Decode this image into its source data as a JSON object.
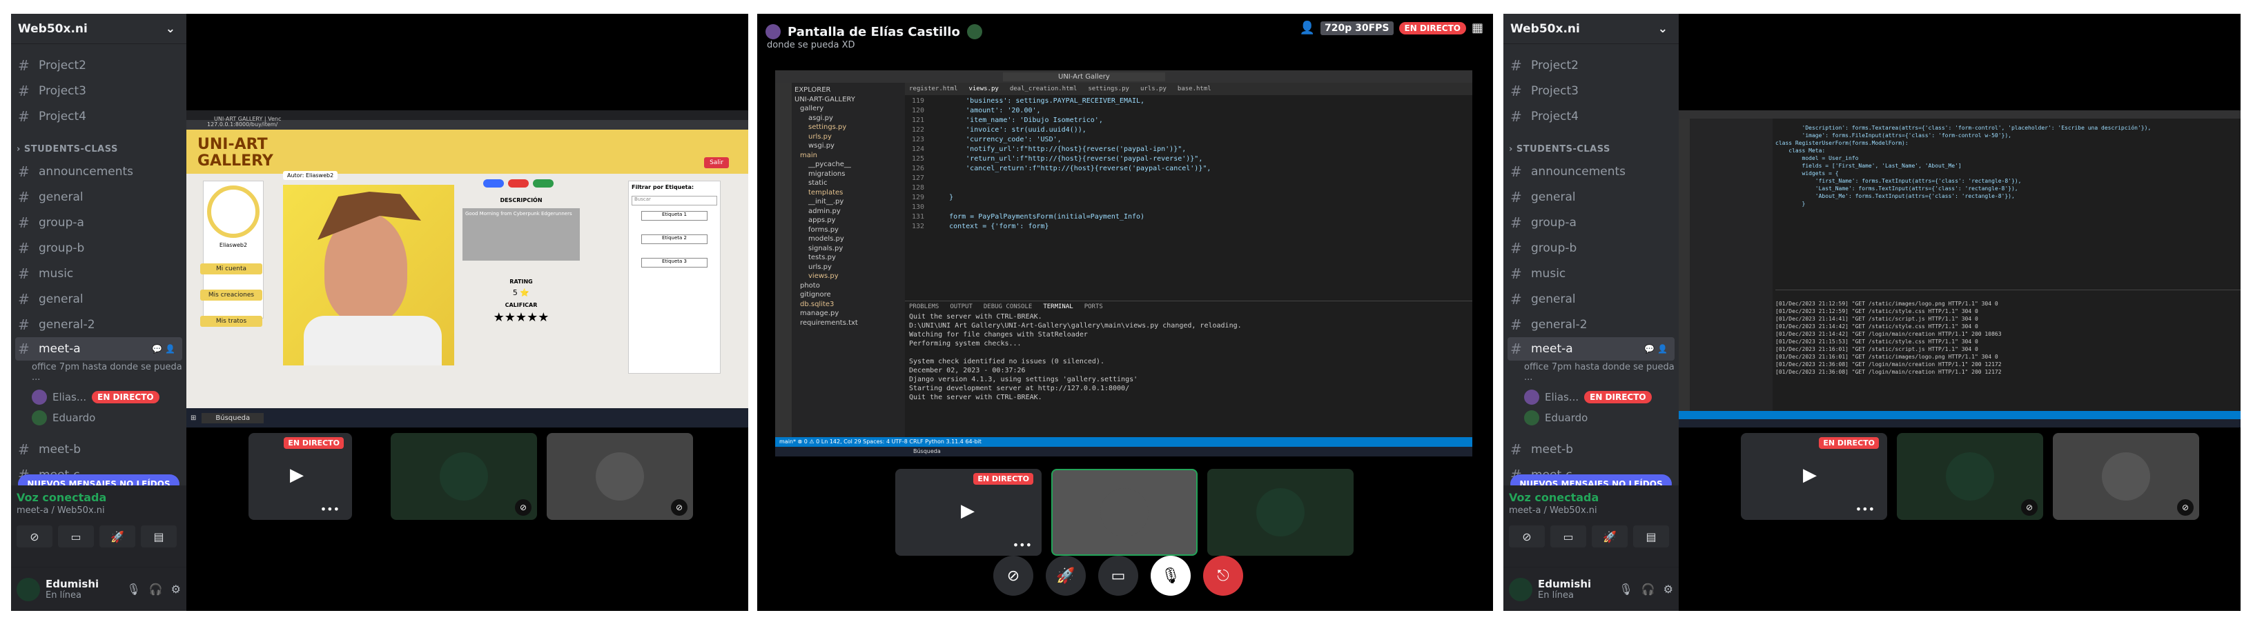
{
  "sidebar": {
    "server": "Web50x.ni",
    "top_channels": [
      "Project2",
      "Project3",
      "Project4"
    ],
    "category": "STUDENTS-CLASS",
    "channels": [
      "announcements",
      "general",
      "group-a",
      "group-b",
      "music",
      "general",
      "general-2"
    ],
    "selected": "meet-a",
    "selected_sub": "office 7pm hasta donde se pueda ...",
    "members": [
      "Elias...",
      "Eduardo"
    ],
    "live_badge": "EN DIRECTO",
    "after": [
      "meet-b",
      "meet-c"
    ],
    "unread": "NUEVOS MENSAJES NO LEÍDOS",
    "voice_status": "Voz conectada",
    "voice_channel": "meet-a / Web50x.ni",
    "user_name": "Edumishi",
    "user_status": "En línea"
  },
  "site": {
    "logo_line1": "UNI-ART",
    "logo_line2": "GALLERY",
    "logout": "Salir",
    "author": "Autor: Eliasweb2",
    "user_label": "Eliasweb2",
    "desc_title": "DESCRIPCIÓN",
    "desc_text": "Good Morning from Cyberpunk Edgerunners",
    "rating_title": "RATING",
    "rating_value": "5 ⭐",
    "rate_title": "CALIFICAR",
    "stars": "★★★★★",
    "side_buttons": [
      "Mi cuenta",
      "Mis creaciones",
      "Mis tratos"
    ],
    "filter_title": "Filtrar por Etiqueta:",
    "search_placeholder": "Buscar",
    "search_btn": "Buscar",
    "tags": [
      "Etiqueta 1",
      "Etiqueta 2",
      "Etiqueta 3"
    ],
    "tab_title": "UNI-ART GALLERY | Venc",
    "url": "127.0.0.1:8000/buy/item/"
  },
  "p2": {
    "title": "Pantalla de Elías Castillo",
    "subtitle": "donde se pueda XD",
    "quality": "720p 30FPS",
    "live": "EN DIRECTO",
    "window_title": "UNI-Art Gallery",
    "explorer": [
      "EXPLORER",
      "UNI-ART-GALLERY",
      "gallery",
      "asgi.py",
      "settings.py",
      "urls.py",
      "wsgi.py",
      "main",
      "__pycache__",
      "migrations",
      "static",
      "templates",
      "__init__.py",
      "admin.py",
      "apps.py",
      "forms.py",
      "models.py",
      "signals.py",
      "tests.py",
      "urls.py",
      "views.py",
      "photo",
      "gitignore",
      "db.sqlite3",
      "manage.py",
      "requirements.txt"
    ],
    "tabs": [
      "register.html",
      "views.py",
      "deal_creation.html",
      "settings.py",
      "urls.py",
      "base.html"
    ],
    "code": [
      {
        "n": "119",
        "t": "        'business': settings.PAYPAL_RECEIVER_EMAIL,"
      },
      {
        "n": "120",
        "t": "        'amount': '20.00',"
      },
      {
        "n": "121",
        "t": "        'item_name': 'Dibujo Isometrico',"
      },
      {
        "n": "122",
        "t": "        'invoice': str(uuid.uuid4()),"
      },
      {
        "n": "123",
        "t": "        'currency_code': 'USD',"
      },
      {
        "n": "124",
        "t": "        'notify_url':f\"http://{host}{reverse('paypal-ipn')}\","
      },
      {
        "n": "125",
        "t": "        'return_url':f\"http://{host}{reverse('paypal-reverse')}\","
      },
      {
        "n": "126",
        "t": "        'cancel_return':f\"http://{host}{reverse('paypal-cancel')}\","
      },
      {
        "n": "127",
        "t": ""
      },
      {
        "n": "128",
        "t": ""
      },
      {
        "n": "129",
        "t": "    }"
      },
      {
        "n": "130",
        "t": ""
      },
      {
        "n": "131",
        "t": "    form = PayPalPaymentsForm(initial=Payment_Info)"
      },
      {
        "n": "132",
        "t": "    context = {'form': form}"
      }
    ],
    "panel_tabs": [
      "PROBLEMS",
      "OUTPUT",
      "DEBUG CONSOLE",
      "TERMINAL",
      "PORTS"
    ],
    "terminal": [
      "Quit the server with CTRL-BREAK.",
      "D:\\UNI\\UNI Art Gallery\\UNI-Art-Gallery\\gallery\\main\\views.py changed, reloading.",
      "Watching for file changes with StatReloader",
      "Performing system checks...",
      "",
      "System check identified no issues (0 silenced).",
      "December 02, 2023 - 00:37:26",
      "Django version 4.1.3, using settings 'gallery.settings'",
      "Starting development server at http://127.0.0.1:8000/",
      "Quit the server with CTRL-BREAK."
    ],
    "status": "main*  ⊗ 0 ⚠ 0    Ln 142, Col 29   Spaces: 4   UTF-8   CRLF   Python 3.11.4 64-bit",
    "taskbar_search": "Búsqueda"
  },
  "p3": {
    "code": [
      "        'Description': forms.Textarea(attrs={'class': 'form-control', 'placeholder': 'Escribe una descripción'}),",
      "        'image': forms.FileInput(attrs={'class': 'form-control w-50'}),",
      "",
      "",
      "class RegisterUserForm(forms.ModelForm):",
      "    class Meta:",
      "        model = User_info",
      "        fields = ['First_Name', 'Last_Name', 'About_Me']",
      "        widgets = {",
      "            'first_Name': forms.TextInput(attrs={'class': 'rectangle-8'}),",
      "            'Last_Name': forms.TextInput(attrs={'class': 'rectangle-8'}),",
      "            'About_Me': forms.TextInput(attrs={'class': 'rectangle-8'}),",
      "        }"
    ],
    "terminal": [
      "[01/Dec/2023 21:12:59] \"GET /static/images/logo.png HTTP/1.1\" 304 0",
      "[01/Dec/2023 21:12:59] \"GET /static/style.css HTTP/1.1\" 304 0",
      "[01/Dec/2023 21:14:41] \"GET /static/script.js HTTP/1.1\" 304 0",
      "[01/Dec/2023 21:14:42] \"GET /static/style.css HTTP/1.1\" 304 0",
      "[01/Dec/2023 21:14:42] \"GET /login/main/creation HTTP/1.1\" 200 10863",
      "[01/Dec/2023 21:15:53] \"GET /static/style.css HTTP/1.1\" 304 0",
      "[01/Dec/2023 21:16:01] \"GET /static/script.js HTTP/1.1\" 304 0",
      "[01/Dec/2023 21:16:01] \"GET /static/images/logo.png HTTP/1.1\" 304 0",
      "[01/Dec/2023 21:36:08] \"GET /login/main/creation HTTP/1.1\" 200 12172",
      "[01/Dec/2023 21:36:08] \"GET /login/main/creation HTTP/1.1\" 200 12172"
    ]
  }
}
